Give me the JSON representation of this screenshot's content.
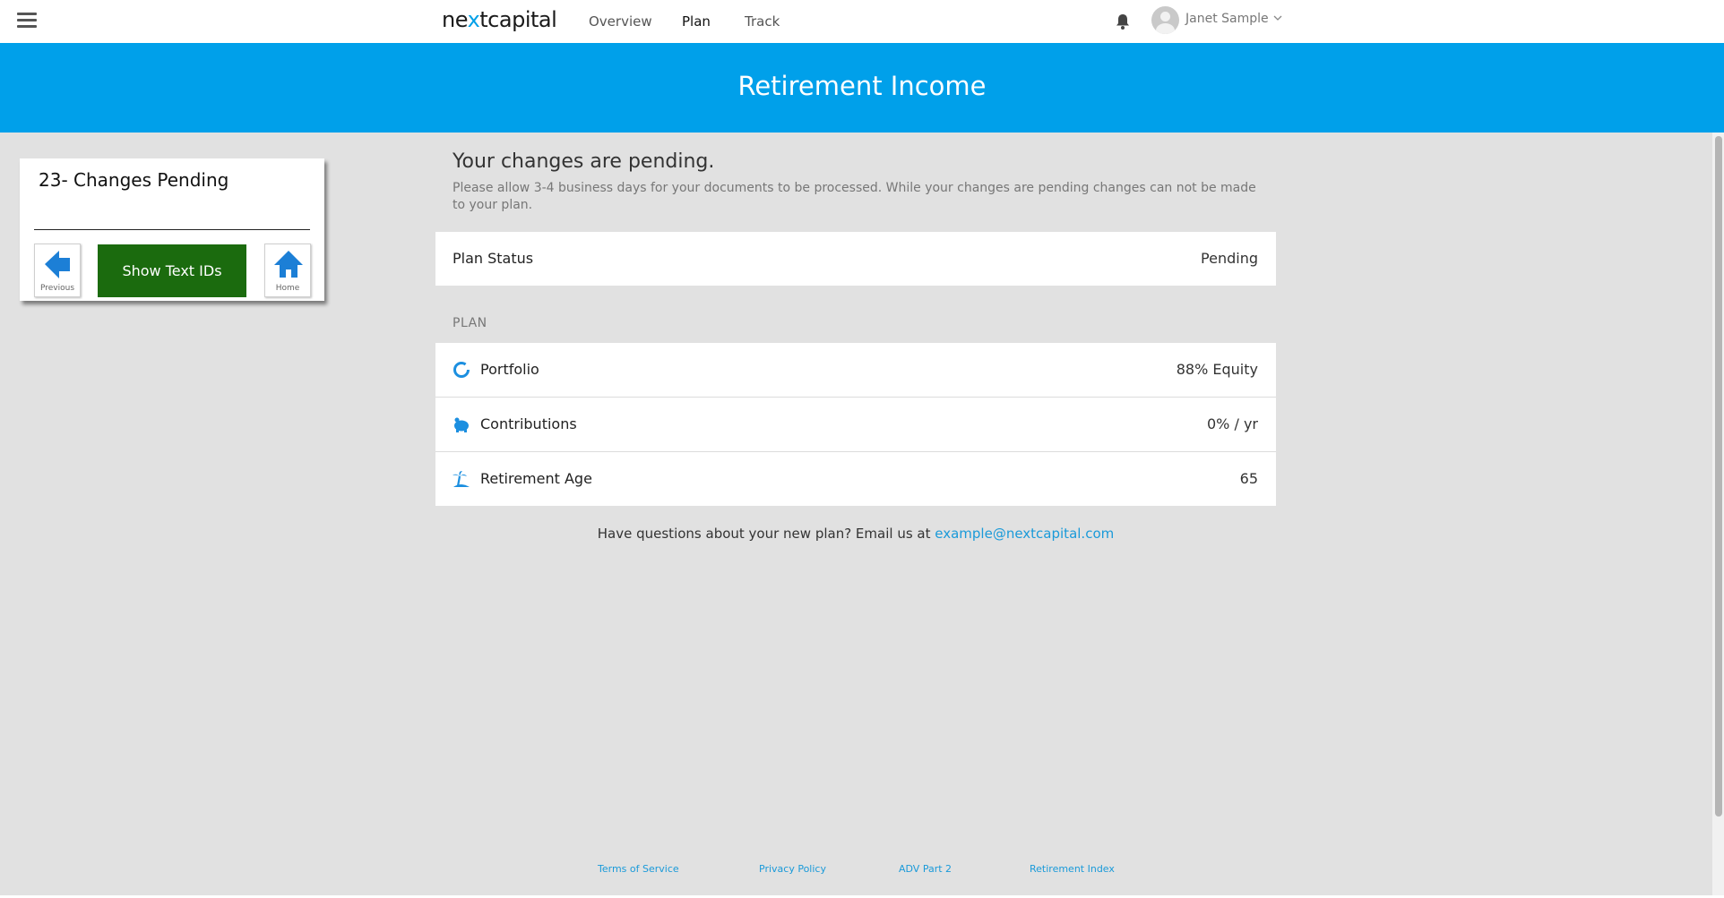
{
  "nav": {
    "logo_pre": "ne",
    "logo_x": "x",
    "logo_post": "tcapital",
    "links": [
      "Overview",
      "Plan",
      "Track"
    ],
    "active": "Plan",
    "user_name": "Janet Sample"
  },
  "banner": {
    "title": "Retirement Income"
  },
  "helper": {
    "title": "23- Changes Pending",
    "previous_label": "Previous",
    "show_ids_label": "Show Text IDs",
    "home_label": "Home"
  },
  "main": {
    "heading": "Your changes are pending.",
    "description": "Please allow 3-4 business days for your documents to be processed. While your changes are pending changes can not be made to your plan.",
    "status": {
      "label": "Plan Status",
      "value": "Pending"
    },
    "section_label": "PLAN",
    "plan_rows": [
      {
        "label": "Portfolio",
        "value": "88% Equity",
        "icon": "donut-chart-icon"
      },
      {
        "label": "Contributions",
        "value": "0% / yr",
        "icon": "piggy-bank-icon"
      },
      {
        "label": "Retirement Age",
        "value": "65",
        "icon": "beach-palm-icon"
      }
    ],
    "questions_text": "Have questions about your new plan? Email us at",
    "email": "example@nextcapital.com"
  },
  "footer": {
    "links": [
      "Terms of Service",
      "Privacy Policy",
      "ADV Part 2",
      "Retirement Index"
    ]
  },
  "colors": {
    "brand_blue": "#00a0ea",
    "link_blue": "#1a9ad9",
    "button_green": "#1b6b0e",
    "background_gray": "#e1e1e1"
  }
}
